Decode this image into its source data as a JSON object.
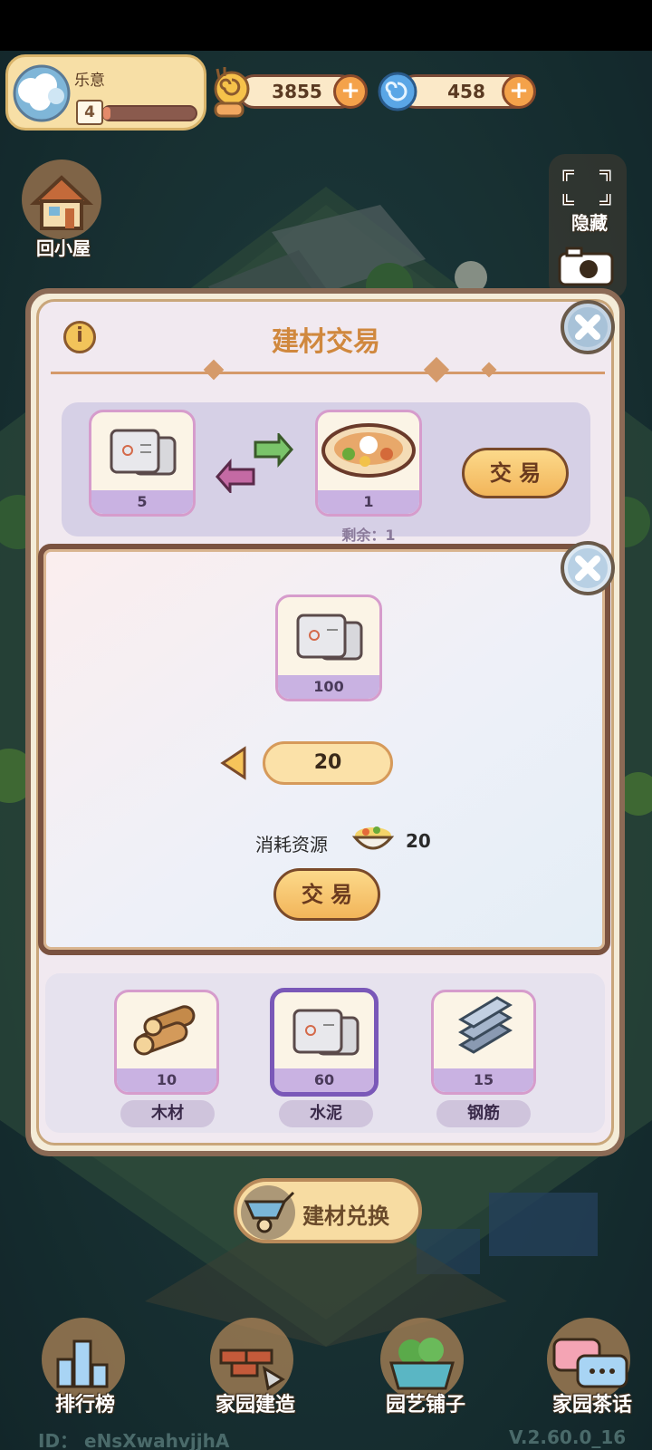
{
  "hud": {
    "player_name": "乐意",
    "level": "4",
    "xp_progress": 0.08,
    "gold": "3855",
    "gems": "458",
    "home_label": "回小屋",
    "hide_label": "隐藏"
  },
  "trade_panel": {
    "title": "建材交易",
    "give_count": "5",
    "get_count": "1",
    "remaining": "剩余：1",
    "trade_label": "交 易"
  },
  "materials": [
    {
      "name": "木材",
      "count": "10",
      "icon": "wood-logs-icon"
    },
    {
      "name": "水泥",
      "count": "60",
      "icon": "cement-bag-icon",
      "selected": true
    },
    {
      "name": "钢筋",
      "count": "15",
      "icon": "steel-bar-icon"
    }
  ],
  "popup": {
    "item_count": "100",
    "quantity": "20",
    "cost_label": "消耗资源",
    "cost_value": "20",
    "trade_label": "交 易"
  },
  "bottom": {
    "exchange_label": "建材兑换",
    "nav": [
      "排行榜",
      "家园建造",
      "园艺铺子",
      "家园茶话"
    ],
    "user_id": "ID： eNsXwahvjjhA",
    "version": "V.2.60.0_16"
  },
  "colors": {
    "accent_gold": "#f2b55a",
    "panel_border": "#8b6a55",
    "card_border": "#d69ccc",
    "selected_border": "#7a58b8",
    "title_orange": "#d0883e"
  }
}
